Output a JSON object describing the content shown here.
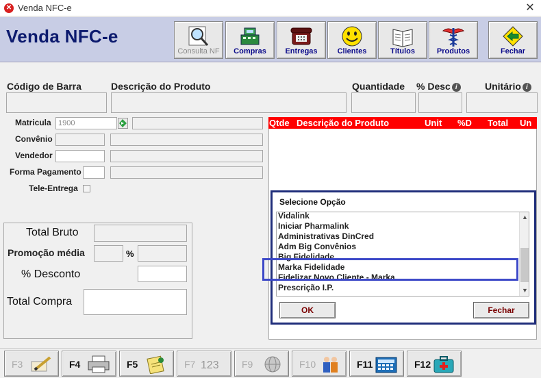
{
  "window": {
    "title": "Venda NFC-e",
    "close_glyph": "✕"
  },
  "header": {
    "heading": "Venda NFC-e",
    "buttons": [
      {
        "label": "Consulta NF",
        "icon": "magnifier-icon",
        "enabled": false
      },
      {
        "label": "Compras",
        "icon": "cash-register-icon",
        "enabled": true
      },
      {
        "label": "Entregas",
        "icon": "phone-icon",
        "enabled": true
      },
      {
        "label": "Clientes",
        "icon": "smiley-icon",
        "enabled": true
      },
      {
        "label": "Títulos",
        "icon": "book-icon",
        "enabled": true
      },
      {
        "label": "Produtos",
        "icon": "caduceus-icon",
        "enabled": true
      },
      {
        "label": "Fechar",
        "icon": "exit-arrow-icon",
        "enabled": true
      }
    ]
  },
  "product": {
    "barcode_label": "Código de Barra",
    "description_label": "Descrição do Produto",
    "quantity_label": "Quantidade",
    "discount_label": "% Desc",
    "unit_label": "Unitário",
    "info_glyph": "i"
  },
  "customer": {
    "matricula_label": "Matricula",
    "matricula_value": "1900",
    "convenio_label": "Convênio",
    "vendedor_label": "Vendedor",
    "forma_pagamento_label": "Forma Pagamento",
    "tele_entrega_label": "Tele-Entrega"
  },
  "totals": {
    "total_bruto_label": "Total Bruto",
    "promocao_label": "Promoção média",
    "percent_sign": "%",
    "desconto_label": "% Desconto",
    "total_compra_label": "Total Compra"
  },
  "items_table": {
    "columns": [
      "Qtde",
      "Descrição do Produto",
      "Unit",
      "%D",
      "Total",
      "Un"
    ]
  },
  "dialog": {
    "title": "Selecione Opção",
    "options": [
      "Vidalink",
      "Iniciar Pharmalink",
      "Administrativas DinCred",
      "Adm Big Convênios",
      "Big Fidelidade",
      "Marka Fidelidade",
      "Fidelizar Novo Cliente - Marka",
      "Prescrição I.P."
    ],
    "ok_label": "OK",
    "close_label": "Fechar"
  },
  "function_keys": [
    {
      "key": "F3",
      "icon": "pencil-paper-icon",
      "enabled": false
    },
    {
      "key": "F4",
      "icon": "printer-icon",
      "enabled": true
    },
    {
      "key": "F5",
      "icon": "notes-icon",
      "enabled": true
    },
    {
      "key": "F7",
      "icon": "numbers-icon",
      "enabled": false,
      "icon_text": "123"
    },
    {
      "key": "F9",
      "icon": "globe-icon",
      "enabled": false
    },
    {
      "key": "F10",
      "icon": "people-icon",
      "enabled": false
    },
    {
      "key": "F11",
      "icon": "calculator-icon",
      "enabled": true
    },
    {
      "key": "F12",
      "icon": "first-aid-icon",
      "enabled": true
    }
  ],
  "colors": {
    "header_bg": "#c8cde5",
    "heading": "#0c1a6e",
    "list_header": "#ff0000",
    "dialog_border": "#1f2d7a",
    "highlight": "#3d49c8"
  }
}
